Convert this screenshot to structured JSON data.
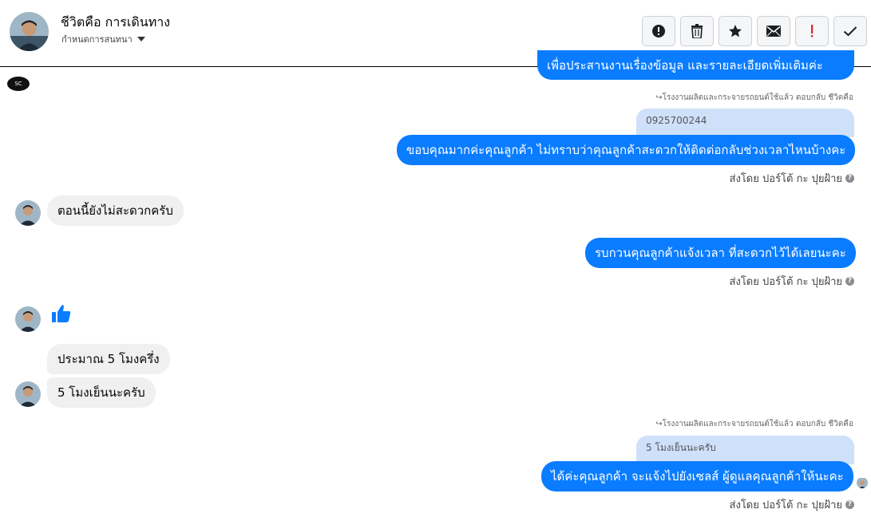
{
  "header": {
    "contact_name": "ชีวิตคือ การเดินทาง",
    "assign_label": "กำหนดการสนทนา",
    "toolbar": [
      {
        "name": "mark-spam-button",
        "icon": "alert-circle-icon"
      },
      {
        "name": "delete-button",
        "icon": "trash-icon"
      },
      {
        "name": "star-button",
        "icon": "star-icon"
      },
      {
        "name": "mark-unread-button",
        "icon": "envelope-icon"
      },
      {
        "name": "follow-up-button",
        "icon": "exclamation-icon"
      },
      {
        "name": "mark-done-button",
        "icon": "check-icon"
      }
    ]
  },
  "page_logo_text": "SC",
  "messages": {
    "cut_top_text": "เพื่อประสานงานเรื่องข้อมูล และรายละเอียดเพิ่มเติมค่ะ",
    "reply1_note": "โรงงานผลิตและกระจายรถยนต์ใช้แล้ว ตอบกลับ ชีวิตคือ",
    "reply1_quote": "0925700244",
    "out1": "ขอบคุณมากค่ะคุณลูกค้า ไม่ทราบว่าคุณลูกค้าสะดวกให้ติดต่อกลับช่วงเวลาไหนบ้างคะ",
    "sent_by_1": "ส่งโดย ปอร์โต้ กะ ปุยฝ้าย",
    "in1": "ตอนนี้ยังไม่สะดวกครับ",
    "out2": "รบกวนคุณลูกค้าแจ้งเวลา ที่สะดวกไว้ได้เลยนะคะ",
    "sent_by_2": "ส่งโดย ปอร์โต้ กะ ปุยฝ้าย",
    "in2": "ประมาณ 5 โมงครึ่ง",
    "in3": "5 โมงเย็นนะครับ",
    "reply2_note": "โรงงานผลิตและกระจายรถยนต์ใช้แล้ว ตอบกลับ ชีวิตคือ",
    "reply2_quote": "5 โมงเย็นนะครับ",
    "out3": "ได้ค่ะคุณลูกค้า จะแจ้งไปยังเซลส์ ผู้ดูแลคุณลูกค้าให้นะคะ",
    "sent_by_3": "ส่งโดย ปอร์โต้ กะ ปุยฝ้าย"
  },
  "colors": {
    "outgoing": "#0a7cff",
    "incoming": "#f0f0f0",
    "quote": "#cfe0fb",
    "like": "#0a7cff"
  }
}
